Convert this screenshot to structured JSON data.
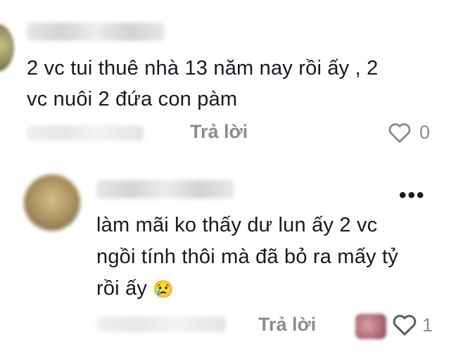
{
  "comments": [
    {
      "text_lines": [
        "2 vc tui thuê nhà 13 năm nay rồi ấy , 2",
        "vc nuôi 2 đứa con pàm"
      ],
      "reply_label": "Trả lời",
      "like_count": "0"
    },
    {
      "text_lines": [
        "làm mãi ko thấy dư lun ấy 2 vc",
        "ngồi tính thôi mà đã bỏ ra mấy tỷ",
        "rồi ấy"
      ],
      "emoji": "😢",
      "reply_label": "Trả lời",
      "like_count": "1",
      "more_label": "•••"
    }
  ],
  "colors": {
    "text": "#161823",
    "muted": "#8a8b91"
  },
  "icons": [
    "heart-outline-icon",
    "more-dots-icon",
    "crying-face-emoji"
  ]
}
